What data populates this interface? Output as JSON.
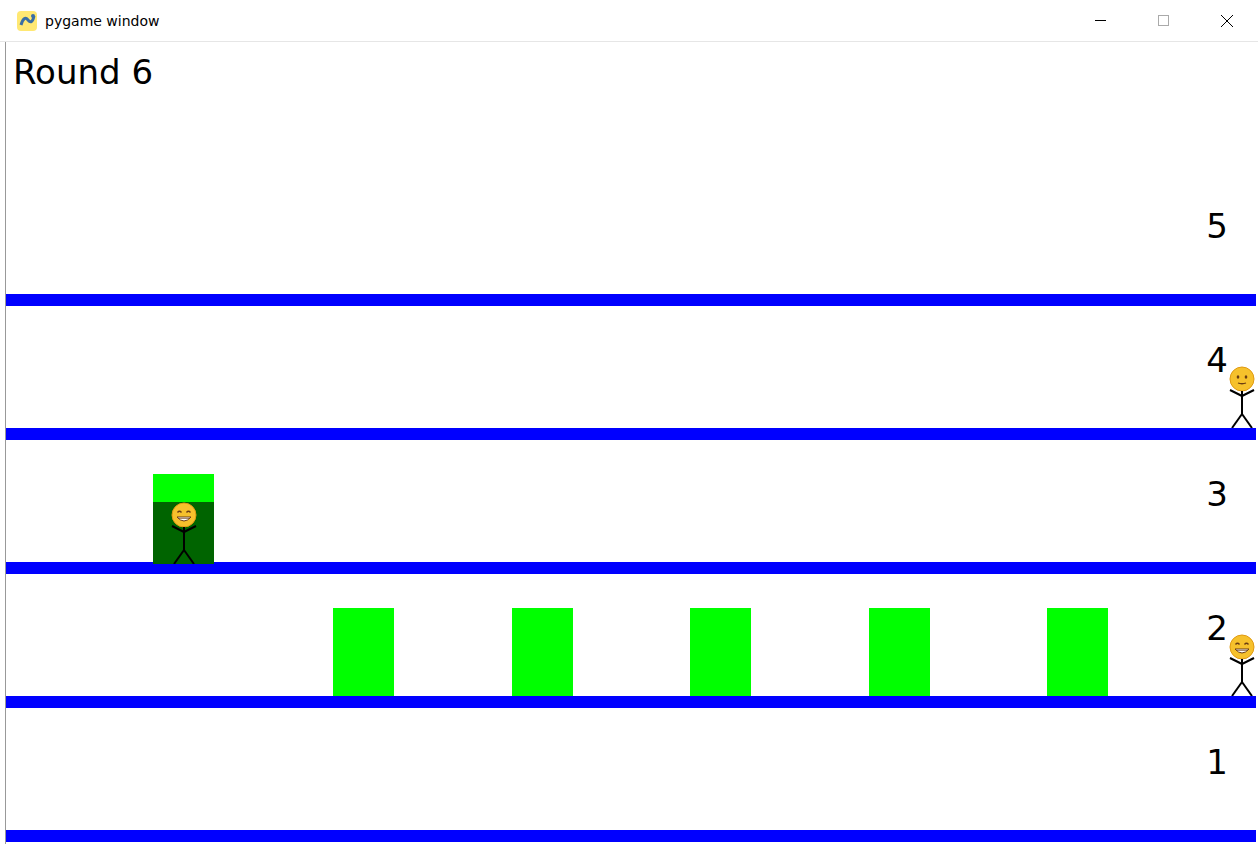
{
  "window": {
    "title": "pygame window"
  },
  "hud": {
    "round": "Round 6"
  },
  "floors": [
    {
      "label": "5",
      "boxes": [],
      "people": []
    },
    {
      "label": "4",
      "boxes": [],
      "people": [
        {
          "kind": "neutral"
        }
      ]
    },
    {
      "label": "3",
      "boxes": [
        {
          "occupied": true,
          "person": {
            "kind": "grinning"
          }
        }
      ],
      "people": []
    },
    {
      "label": "2",
      "boxes": [
        {
          "occupied": false
        },
        {
          "occupied": false
        },
        {
          "occupied": false
        },
        {
          "occupied": false
        },
        {
          "occupied": false
        }
      ],
      "people": [
        {
          "kind": "grinning"
        }
      ]
    },
    {
      "label": "1",
      "boxes": [],
      "people": []
    }
  ]
}
